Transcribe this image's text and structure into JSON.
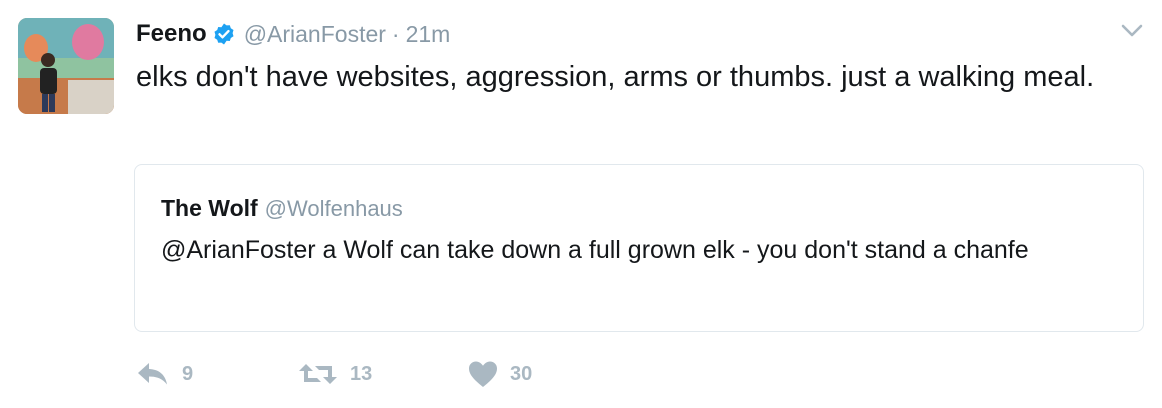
{
  "tweet": {
    "display_name": "Feeno",
    "handle": "@ArianFoster",
    "separator": "·",
    "time": "21m",
    "text": "elks don't have websites, aggression, arms or thumbs. just a walking meal.",
    "avatar_icon": "profile-photo",
    "verified_icon": "verified-badge-icon",
    "verified_color": "#1da1f2"
  },
  "quoted_tweet": {
    "display_name": "The Wolf",
    "handle": "@Wolfenhaus",
    "text": "@ArianFoster a Wolf can take down a full grown elk - you don't stand a chanfe"
  },
  "actions": {
    "reply_count": "9",
    "retweet_count": "13",
    "like_count": "30",
    "icon_color": "#aab8c2"
  },
  "menu_icon": "chevron-down-icon"
}
